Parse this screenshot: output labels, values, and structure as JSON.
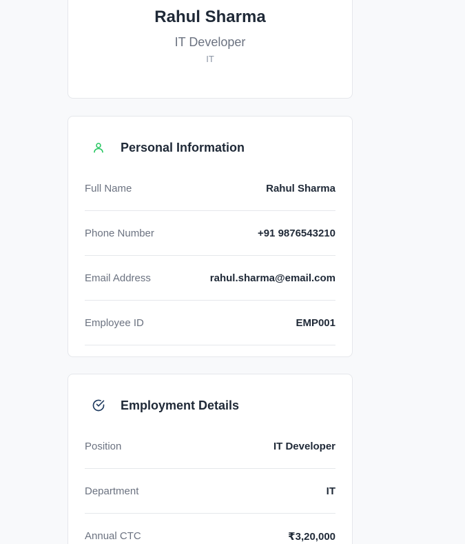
{
  "profile": {
    "name": "Rahul Sharma",
    "role": "IT Developer",
    "department": "IT"
  },
  "personal_info": {
    "title": "Personal Information",
    "icon": "user-icon",
    "accent": "#22c55e",
    "rows": [
      {
        "label": "Full Name",
        "value": "Rahul Sharma"
      },
      {
        "label": "Phone Number",
        "value": "+91 9876543210"
      },
      {
        "label": "Email Address",
        "value": "rahul.sharma@email.com"
      },
      {
        "label": "Employee ID",
        "value": "EMP001"
      }
    ]
  },
  "employment": {
    "title": "Employment Details",
    "icon": "check-circle-icon",
    "accent": "#1e3a5f",
    "rows": [
      {
        "label": "Position",
        "value": "IT Developer"
      },
      {
        "label": "Department",
        "value": "IT"
      },
      {
        "label": "Annual CTC",
        "value": "₹3,20,000"
      }
    ]
  }
}
